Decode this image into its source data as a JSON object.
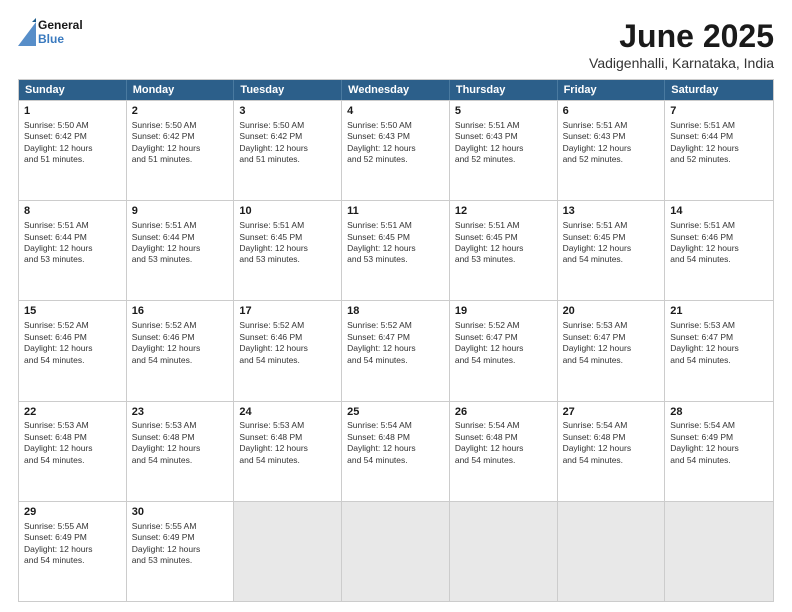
{
  "header": {
    "logo_line1": "General",
    "logo_line2": "Blue",
    "title": "June 2025",
    "subtitle": "Vadigenhalli, Karnataka, India"
  },
  "days_of_week": [
    "Sunday",
    "Monday",
    "Tuesday",
    "Wednesday",
    "Thursday",
    "Friday",
    "Saturday"
  ],
  "rows": [
    [
      {
        "day": "1",
        "data": "Sunrise: 5:50 AM\nSunset: 6:42 PM\nDaylight: 12 hours\nand 51 minutes."
      },
      {
        "day": "2",
        "data": "Sunrise: 5:50 AM\nSunset: 6:42 PM\nDaylight: 12 hours\nand 51 minutes."
      },
      {
        "day": "3",
        "data": "Sunrise: 5:50 AM\nSunset: 6:42 PM\nDaylight: 12 hours\nand 51 minutes."
      },
      {
        "day": "4",
        "data": "Sunrise: 5:50 AM\nSunset: 6:43 PM\nDaylight: 12 hours\nand 52 minutes."
      },
      {
        "day": "5",
        "data": "Sunrise: 5:51 AM\nSunset: 6:43 PM\nDaylight: 12 hours\nand 52 minutes."
      },
      {
        "day": "6",
        "data": "Sunrise: 5:51 AM\nSunset: 6:43 PM\nDaylight: 12 hours\nand 52 minutes."
      },
      {
        "day": "7",
        "data": "Sunrise: 5:51 AM\nSunset: 6:44 PM\nDaylight: 12 hours\nand 52 minutes."
      }
    ],
    [
      {
        "day": "8",
        "data": "Sunrise: 5:51 AM\nSunset: 6:44 PM\nDaylight: 12 hours\nand 53 minutes."
      },
      {
        "day": "9",
        "data": "Sunrise: 5:51 AM\nSunset: 6:44 PM\nDaylight: 12 hours\nand 53 minutes."
      },
      {
        "day": "10",
        "data": "Sunrise: 5:51 AM\nSunset: 6:45 PM\nDaylight: 12 hours\nand 53 minutes."
      },
      {
        "day": "11",
        "data": "Sunrise: 5:51 AM\nSunset: 6:45 PM\nDaylight: 12 hours\nand 53 minutes."
      },
      {
        "day": "12",
        "data": "Sunrise: 5:51 AM\nSunset: 6:45 PM\nDaylight: 12 hours\nand 53 minutes."
      },
      {
        "day": "13",
        "data": "Sunrise: 5:51 AM\nSunset: 6:45 PM\nDaylight: 12 hours\nand 54 minutes."
      },
      {
        "day": "14",
        "data": "Sunrise: 5:51 AM\nSunset: 6:46 PM\nDaylight: 12 hours\nand 54 minutes."
      }
    ],
    [
      {
        "day": "15",
        "data": "Sunrise: 5:52 AM\nSunset: 6:46 PM\nDaylight: 12 hours\nand 54 minutes."
      },
      {
        "day": "16",
        "data": "Sunrise: 5:52 AM\nSunset: 6:46 PM\nDaylight: 12 hours\nand 54 minutes."
      },
      {
        "day": "17",
        "data": "Sunrise: 5:52 AM\nSunset: 6:46 PM\nDaylight: 12 hours\nand 54 minutes."
      },
      {
        "day": "18",
        "data": "Sunrise: 5:52 AM\nSunset: 6:47 PM\nDaylight: 12 hours\nand 54 minutes."
      },
      {
        "day": "19",
        "data": "Sunrise: 5:52 AM\nSunset: 6:47 PM\nDaylight: 12 hours\nand 54 minutes."
      },
      {
        "day": "20",
        "data": "Sunrise: 5:53 AM\nSunset: 6:47 PM\nDaylight: 12 hours\nand 54 minutes."
      },
      {
        "day": "21",
        "data": "Sunrise: 5:53 AM\nSunset: 6:47 PM\nDaylight: 12 hours\nand 54 minutes."
      }
    ],
    [
      {
        "day": "22",
        "data": "Sunrise: 5:53 AM\nSunset: 6:48 PM\nDaylight: 12 hours\nand 54 minutes."
      },
      {
        "day": "23",
        "data": "Sunrise: 5:53 AM\nSunset: 6:48 PM\nDaylight: 12 hours\nand 54 minutes."
      },
      {
        "day": "24",
        "data": "Sunrise: 5:53 AM\nSunset: 6:48 PM\nDaylight: 12 hours\nand 54 minutes."
      },
      {
        "day": "25",
        "data": "Sunrise: 5:54 AM\nSunset: 6:48 PM\nDaylight: 12 hours\nand 54 minutes."
      },
      {
        "day": "26",
        "data": "Sunrise: 5:54 AM\nSunset: 6:48 PM\nDaylight: 12 hours\nand 54 minutes."
      },
      {
        "day": "27",
        "data": "Sunrise: 5:54 AM\nSunset: 6:48 PM\nDaylight: 12 hours\nand 54 minutes."
      },
      {
        "day": "28",
        "data": "Sunrise: 5:54 AM\nSunset: 6:49 PM\nDaylight: 12 hours\nand 54 minutes."
      }
    ],
    [
      {
        "day": "29",
        "data": "Sunrise: 5:55 AM\nSunset: 6:49 PM\nDaylight: 12 hours\nand 54 minutes."
      },
      {
        "day": "30",
        "data": "Sunrise: 5:55 AM\nSunset: 6:49 PM\nDaylight: 12 hours\nand 53 minutes."
      },
      {
        "day": "",
        "data": ""
      },
      {
        "day": "",
        "data": ""
      },
      {
        "day": "",
        "data": ""
      },
      {
        "day": "",
        "data": ""
      },
      {
        "day": "",
        "data": ""
      }
    ]
  ]
}
